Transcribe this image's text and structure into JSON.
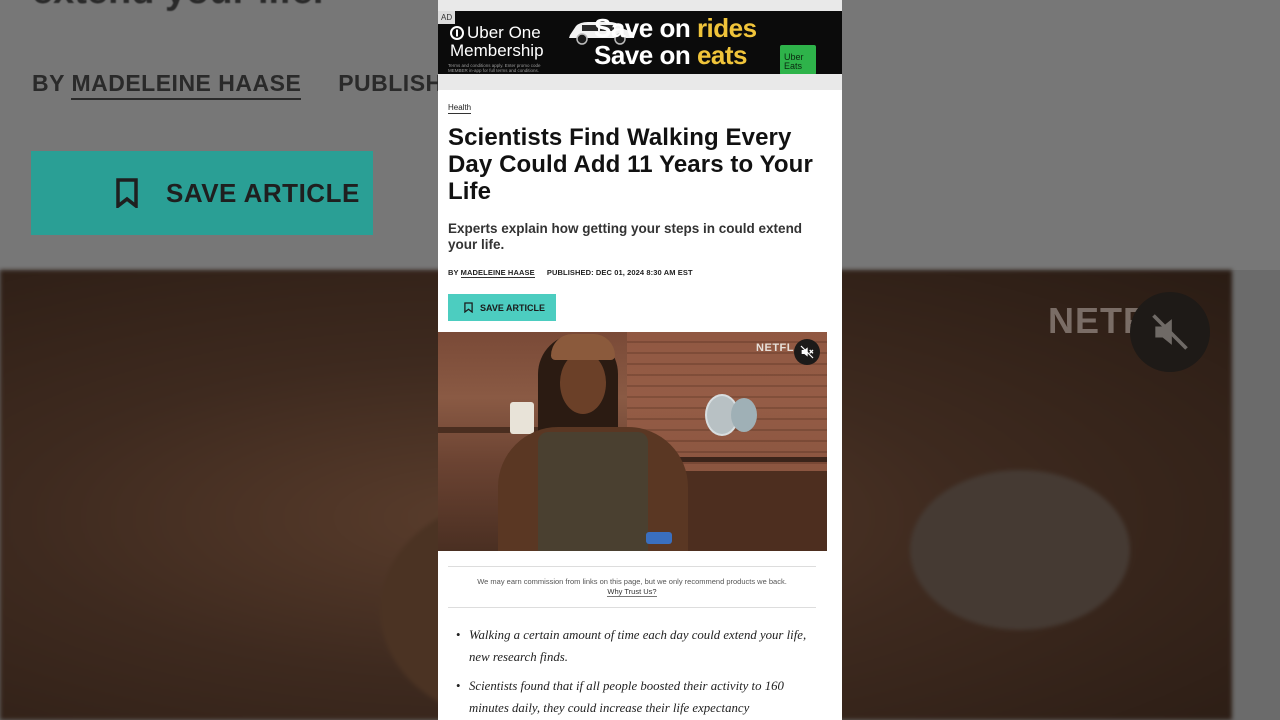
{
  "background": {
    "title_fragment": "extend your life.",
    "byline_prefix": "BY",
    "author": "MADELEINE HAASE",
    "published_fragment": "PUBLISH",
    "save_label": "SAVE ARTICLE",
    "video_watermark": "NETFL"
  },
  "ad": {
    "tag": "AD",
    "brand_line1": "Uber One",
    "brand_line2": "Membership",
    "fine_print": "Terms and conditions apply. Enter promo code MEMBER in-app for full terms and conditions.",
    "headline_part1": "Save on ",
    "headline_hl1": "rides",
    "headline_part2": "Save on ",
    "headline_hl2": "eats",
    "bag_text": "Uber Eats"
  },
  "article": {
    "category": "Health",
    "headline": "Scientists Find Walking Every Day Could Add 11 Years to Your Life",
    "dek": "Experts explain how getting your steps in could extend your life.",
    "byline_prefix": "BY",
    "author": "MADELEINE HAASE",
    "published": "PUBLISHED: DEC 01, 2024 8:30 AM EST",
    "save_label": "SAVE ARTICLE",
    "video_watermark": "NETFL",
    "disclosure_text": "We may earn commission from links on this page, but we only recommend products we back.",
    "disclosure_link": "Why Trust Us?",
    "bullets": [
      "Walking a certain amount of time each day could extend your life, new research finds.",
      "Scientists found that if all people boosted their activity to 160 minutes daily, they could increase their life expectancy"
    ]
  },
  "colors": {
    "save_button": "#4ccdc0",
    "ad_highlight": "#f0c43a"
  }
}
